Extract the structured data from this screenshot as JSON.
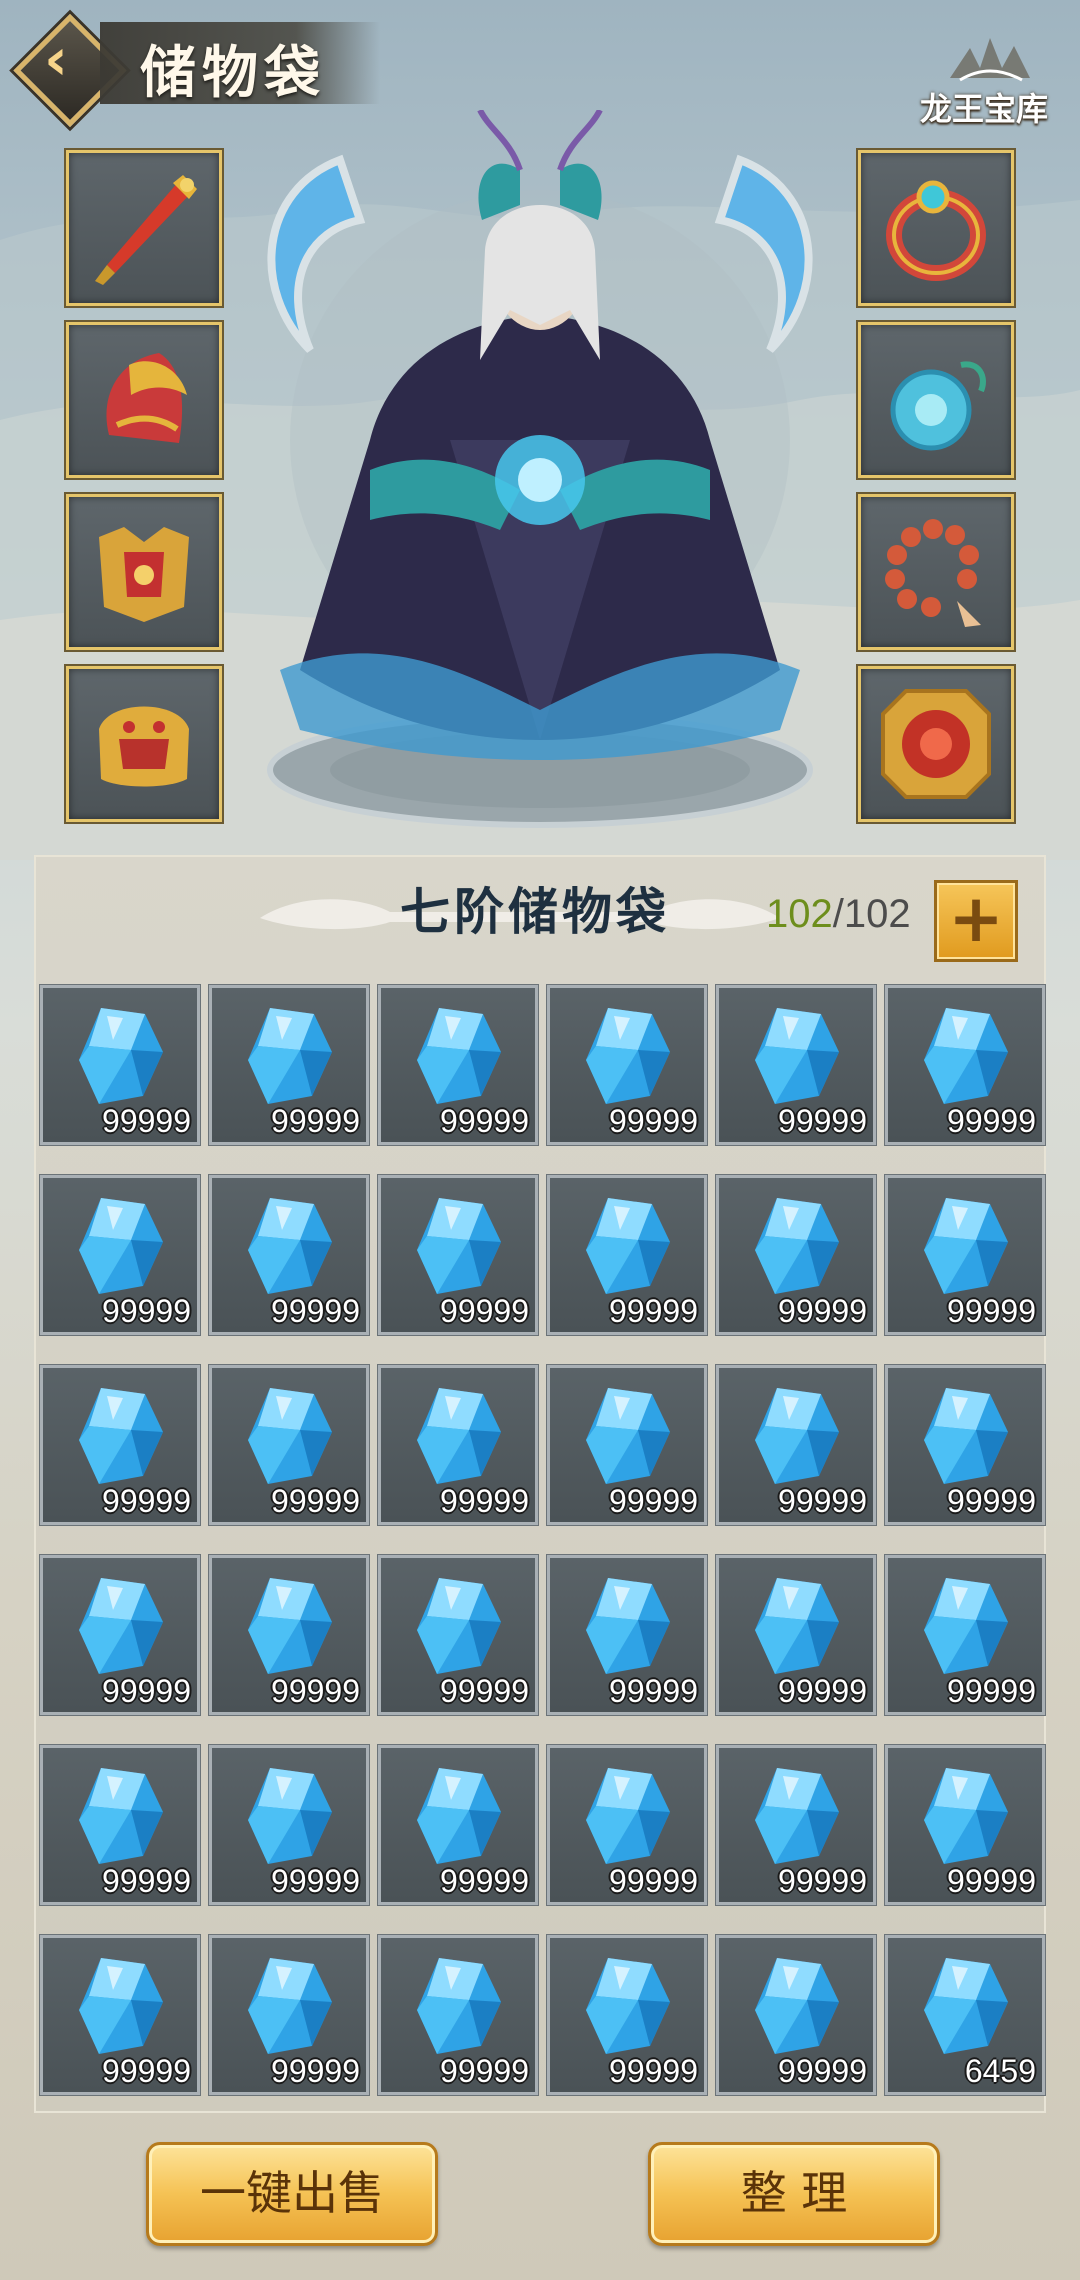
{
  "header": {
    "back_icon": "chevron-left-icon",
    "title": "储物袋",
    "event_logo_text": "龙王宝库"
  },
  "equipment": {
    "left": [
      {
        "name": "sword",
        "icon": "sword-icon"
      },
      {
        "name": "helmet",
        "icon": "helmet-icon"
      },
      {
        "name": "armor",
        "icon": "armor-icon"
      },
      {
        "name": "boots",
        "icon": "boots-icon"
      }
    ],
    "right": [
      {
        "name": "ring",
        "icon": "ring-icon"
      },
      {
        "name": "pendant",
        "icon": "pendant-icon"
      },
      {
        "name": "prayer-beads",
        "icon": "beads-icon"
      },
      {
        "name": "talisman",
        "icon": "talisman-icon"
      }
    ]
  },
  "bag": {
    "title": "七阶储物袋",
    "capacity_used": "102",
    "capacity_sep": "/",
    "capacity_total": "102",
    "add_icon": "plus-icon",
    "item_icon": "crystal-icon",
    "items": [
      "99999",
      "99999",
      "99999",
      "99999",
      "99999",
      "99999",
      "99999",
      "99999",
      "99999",
      "99999",
      "99999",
      "99999",
      "99999",
      "99999",
      "99999",
      "99999",
      "99999",
      "99999",
      "99999",
      "99999",
      "99999",
      "99999",
      "99999",
      "99999",
      "99999",
      "99999",
      "99999",
      "99999",
      "99999",
      "99999",
      "99999",
      "99999",
      "99999",
      "99999",
      "99999",
      "6459"
    ]
  },
  "actions": {
    "sell_all": "一键出售",
    "sort": "整 理"
  },
  "colors": {
    "slot_border": "#e5c56a",
    "capacity_used": "#6d8e1c",
    "button_gold": "#f5c254",
    "crystal": "#3ab4f0"
  }
}
